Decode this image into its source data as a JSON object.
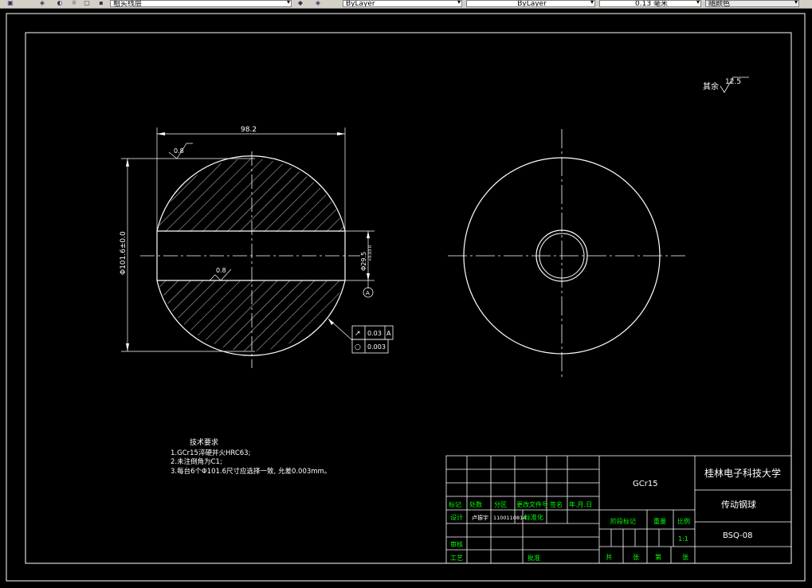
{
  "toolbar": {
    "layer_name": "粗实线层",
    "color_value": "ByLayer",
    "linetype_value": "ByLayer",
    "lineweight_value": "0.13 毫米",
    "plotstyle_value": "随颜色"
  },
  "drawing": {
    "roughness_other_label": "其余",
    "roughness_other_value": "12.5",
    "dim_width": "98.2",
    "dim_diameter": "Φ101.6±0.0",
    "dim_bore": "Φ29.5",
    "dim_bore_tol": "+0.03\n0",
    "roughness_top": "0.8",
    "roughness_bore": "0.8",
    "datum_label": "A",
    "gdt": [
      {
        "symbol": "↗",
        "value": "0.03",
        "datum": "A"
      },
      {
        "symbol": "○",
        "value": "0.003",
        "datum": ""
      }
    ]
  },
  "notes": {
    "title": "技术要求",
    "lines": [
      "1.GCr15淬硬并火HRC63;",
      "2.未注倒角为C1;",
      "3.每台6个Φ101.6尺寸应选择一致, 允差0.003mm。"
    ]
  },
  "title_block": {
    "material": "GCr15",
    "school": "桂林电子科技大学",
    "part_name": "传动钢球",
    "drawing_no": "BSQ-08",
    "scale": "1:1",
    "headers": [
      "标记",
      "处数",
      "分区",
      "更改文件号",
      "签名",
      "年.月.日"
    ],
    "design_label": "设计",
    "designer": "卢振宇",
    "date": "1100110814",
    "standard_label": "标准化",
    "review_label": "审核",
    "process_label": "工艺",
    "approve_label": "批准",
    "stage_label": "阶段标记",
    "weight_label": "重量",
    "scale_label": "比例",
    "sheet_labels": [
      "共",
      "张",
      "第",
      "张"
    ]
  },
  "colors": {
    "line": "#ffffff",
    "title_green": "#00ff00",
    "background": "#000000"
  }
}
